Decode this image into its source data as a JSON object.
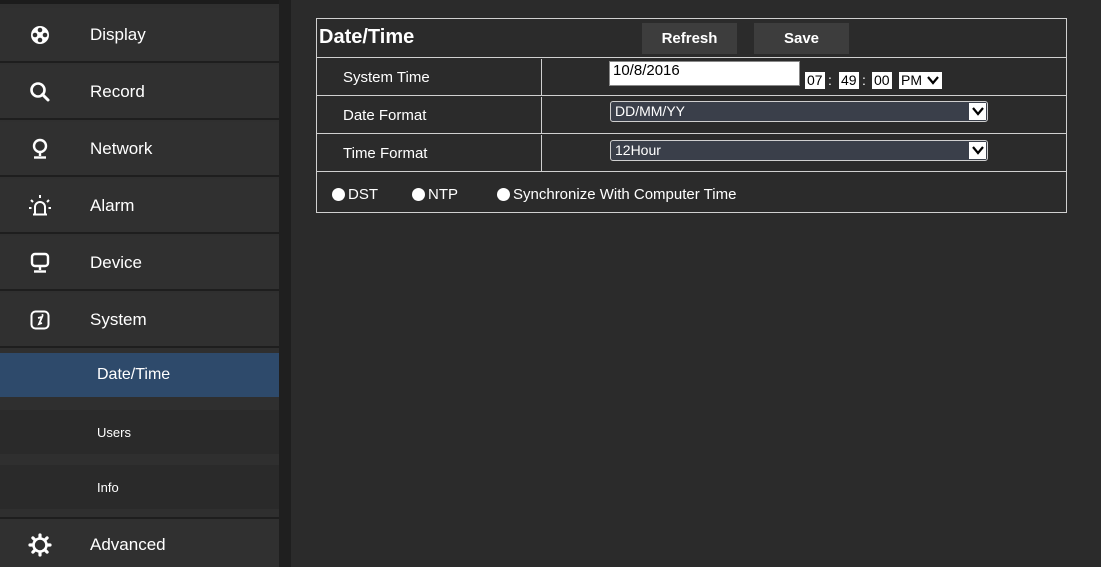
{
  "sidebar": {
    "items": [
      {
        "label": "Display",
        "icon": "film-reel-icon"
      },
      {
        "label": "Record",
        "icon": "search-icon"
      },
      {
        "label": "Network",
        "icon": "network-icon"
      },
      {
        "label": "Alarm",
        "icon": "alarm-icon"
      },
      {
        "label": "Device",
        "icon": "monitor-icon"
      },
      {
        "label": "System",
        "icon": "system-info-icon"
      }
    ],
    "sub_items": [
      {
        "label": "Date/Time",
        "active": true
      },
      {
        "label": "Users",
        "active": false
      },
      {
        "label": "Info",
        "active": false
      }
    ],
    "advanced": {
      "label": "Advanced",
      "icon": "gear-icon"
    }
  },
  "panel": {
    "title": "Date/Time",
    "refresh_label": "Refresh",
    "save_label": "Save",
    "system_time": {
      "label": "System Time",
      "date": "10/8/2016",
      "hour": "07",
      "minute": "49",
      "second": "00",
      "ampm": "PM"
    },
    "date_format": {
      "label": "Date Format",
      "value": "DD/MM/YY"
    },
    "time_format": {
      "label": "Time Format",
      "value": "12Hour"
    },
    "options": {
      "dst": "DST",
      "ntp": "NTP",
      "sync": "Synchronize With Computer Time"
    }
  },
  "colors": {
    "active_sub_item": "#2e4a6b",
    "background": "#2b2b2b"
  }
}
